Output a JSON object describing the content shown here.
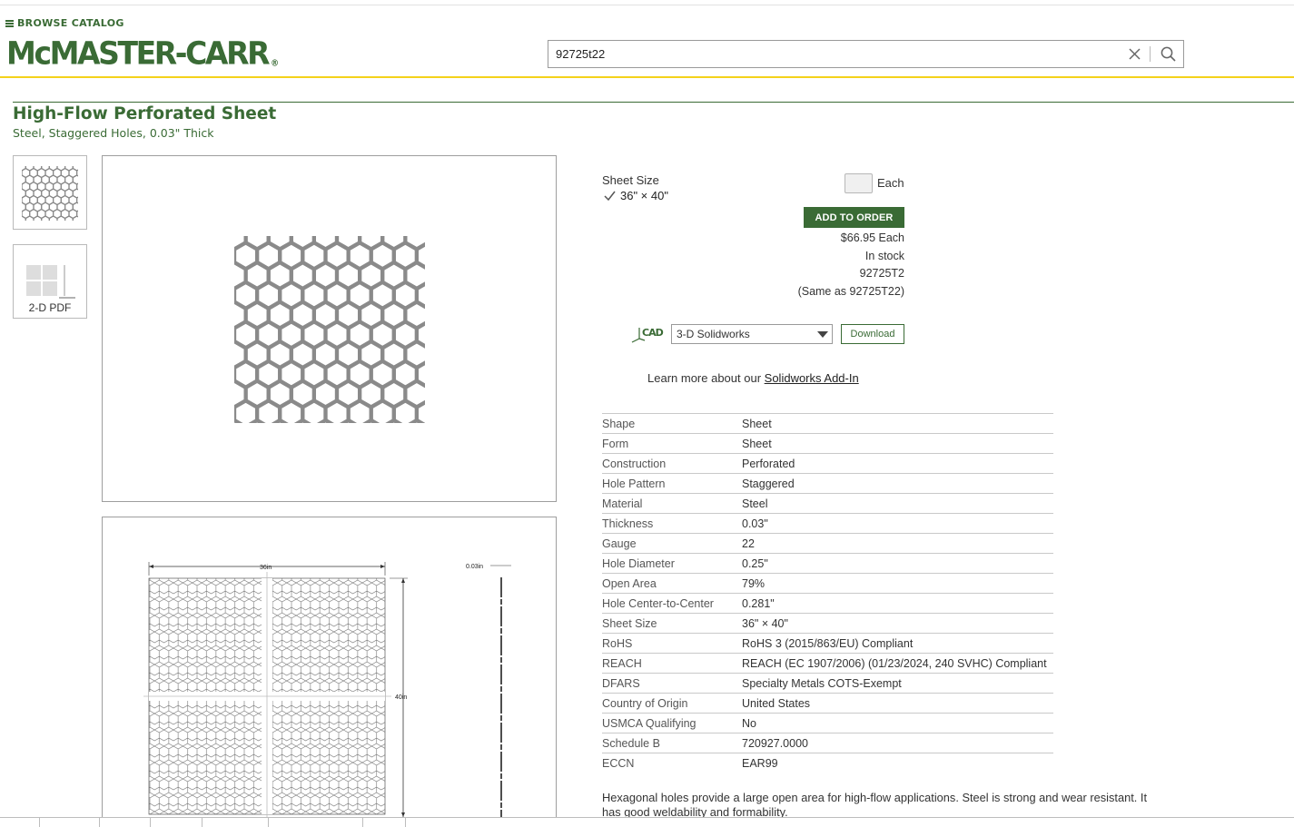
{
  "header": {
    "browse_label": "BROWSE CATALOG",
    "logo_text": "McMASTER-CARR",
    "logo_reg": "®",
    "search_value": "92725t22"
  },
  "product": {
    "title": "High-Flow Perforated Sheet",
    "subtitle": "Steel, Staggered Holes, 0.03\" Thick",
    "pdf_label": "2-D PDF"
  },
  "drawing": {
    "width_label": "36in",
    "height_label": "40in",
    "thickness_label": "0.03in"
  },
  "order": {
    "sheet_size_label": "Sheet Size",
    "sheet_size_value": "36\" × 40\"",
    "each_label": "Each",
    "add_to_order": "ADD TO ORDER",
    "price": "$66.95 Each",
    "stock": "In stock",
    "part_number": "92725T2",
    "same_as": "(Same as 92725T22)"
  },
  "cad": {
    "icon_text": "CAD",
    "format": "3-D Solidworks",
    "download": "Download",
    "learn_prefix": "Learn more about our",
    "learn_link": "Solidworks Add-In"
  },
  "specs": [
    {
      "key": "Shape",
      "value": "Sheet"
    },
    {
      "key": "Form",
      "value": "Sheet"
    },
    {
      "key": "Construction",
      "value": "Perforated"
    },
    {
      "key": "Hole Pattern",
      "value": "Staggered"
    },
    {
      "key": "Material",
      "value": "Steel"
    },
    {
      "key": "Thickness",
      "value": "0.03\""
    },
    {
      "key": "Gauge",
      "value": "22"
    },
    {
      "key": "Hole Diameter",
      "value": "0.25\""
    },
    {
      "key": "Open Area",
      "value": "79%"
    },
    {
      "key": "Hole Center-to-Center",
      "value": "0.281\""
    },
    {
      "key": "Sheet Size",
      "value": "36\" × 40\""
    },
    {
      "key": "RoHS",
      "value": "RoHS 3 (2015/863/EU) Compliant"
    },
    {
      "key": "REACH",
      "value": "REACH (EC 1907/2006) (01/23/2024, 240 SVHC) Compliant"
    },
    {
      "key": "DFARS",
      "value": "Specialty Metals COTS-Exempt"
    },
    {
      "key": "Country of Origin",
      "value": "United States"
    },
    {
      "key": "USMCA Qualifying",
      "value": "No"
    },
    {
      "key": "Schedule B",
      "value": "720927.0000"
    },
    {
      "key": "ECCN",
      "value": "EAR99"
    }
  ],
  "description": "Hexagonal holes provide a large open area for high-flow applications. Steel is strong and wear resistant. It has good weldability and formability.",
  "colors": {
    "brand_green": "#3a6b35",
    "accent_yellow": "#f4d21b"
  }
}
